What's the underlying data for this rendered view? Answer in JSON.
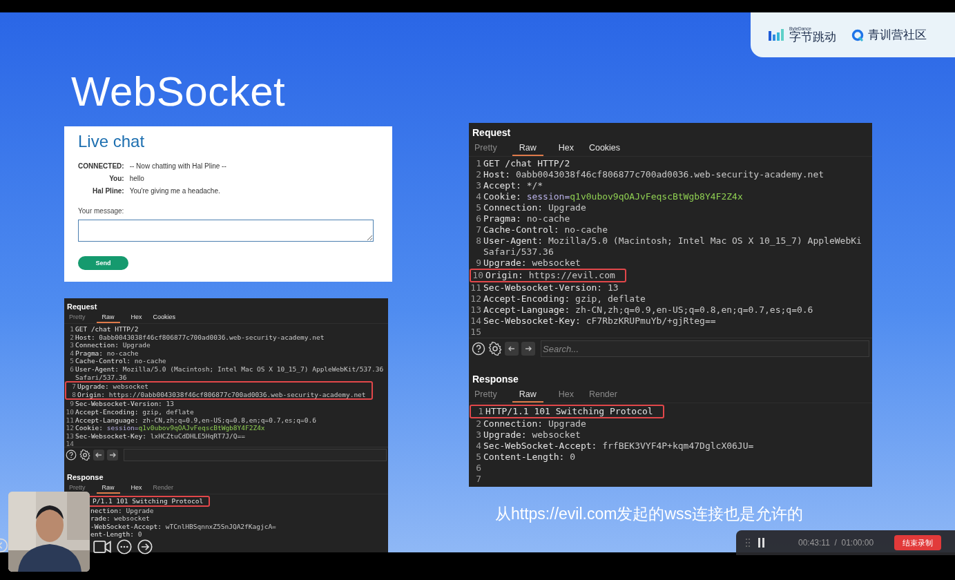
{
  "slide": {
    "title": "WebSocket",
    "logo": {
      "brand_small": "ByteDance",
      "brand": "字节跳动",
      "community": "青训营社区"
    },
    "chat": {
      "title": "Live chat",
      "messages": [
        {
          "sender": "CONNECTED:",
          "text": "-- Now chatting with Hal Pline --"
        },
        {
          "sender": "You:",
          "text": "hello"
        },
        {
          "sender": "Hal Pline:",
          "text": "You're giving me a headache."
        }
      ],
      "message_label": "Your message:",
      "send_button": "Send"
    },
    "left_panel": {
      "request": {
        "title": "Request",
        "tabs": [
          {
            "label": "Pretty",
            "selected": false,
            "disabled": true
          },
          {
            "label": "Raw",
            "selected": true,
            "disabled": false
          },
          {
            "label": "Hex",
            "selected": false,
            "disabled": false
          },
          {
            "label": "Cookies",
            "selected": false,
            "disabled": false
          }
        ],
        "lines": [
          {
            "n": "1",
            "text": "GET /chat HTTP/2",
            "highlighted": false
          },
          {
            "n": "2",
            "name": "Host:",
            "value": "0abb0043038f46cf806877c700ad0036.web-security-academy.net",
            "highlighted": false
          },
          {
            "n": "3",
            "name": "Connection:",
            "value": "Upgrade",
            "highlighted": false
          },
          {
            "n": "4",
            "name": "Pragma:",
            "value": "no-cache",
            "highlighted": false
          },
          {
            "n": "5",
            "name": "Cache-Control:",
            "value": "no-cache",
            "highlighted": false
          },
          {
            "n": "6",
            "name": "User-Agent:",
            "value": "Mozilla/5.0 (Macintosh; Intel Mac OS X 10_15_7) AppleWebKit/537.36",
            "highlighted": false
          },
          {
            "value": "Safari/537.36",
            "highlighted": false
          },
          {
            "n": "7",
            "name": "Upgrade:",
            "value": "websocket",
            "highlighted": true
          },
          {
            "n": "8",
            "name": "Origin:",
            "value": "https://0abb0043038f46cf806877c700ad0036.web-security-academy.net",
            "highlighted": true
          },
          {
            "n": "9",
            "name": "Sec-Websocket-Version:",
            "value": "13",
            "highlighted": false
          },
          {
            "n": "10",
            "name": "Accept-Encoding:",
            "value": "gzip, deflate",
            "highlighted": false
          },
          {
            "n": "11",
            "name": "Accept-Language:",
            "value": "zh-CN,zh;q=0.9,en-US;q=0.8,en;q=0.7,es;q=0.6",
            "highlighted": false
          },
          {
            "n": "12",
            "name": "Cookie:",
            "cookie_name": "session=",
            "value": "q1v0ubov9qOAJvFeqscBtWgb8Y4F2Z4x",
            "highlighted": false
          },
          {
            "n": "13",
            "name": "Sec-Websocket-Key:",
            "value": "lxHCZtuCdDHLE5HqRT7J/Q==",
            "highlighted": false
          },
          {
            "n": "14",
            "highlighted": false
          }
        ]
      },
      "response": {
        "title": "Response",
        "tabs": [
          {
            "label": "Pretty",
            "selected": false,
            "disabled": true
          },
          {
            "label": "Raw",
            "selected": true,
            "disabled": false
          },
          {
            "label": "Hex",
            "selected": false,
            "disabled": false
          },
          {
            "label": "Render",
            "selected": false,
            "disabled": true
          }
        ],
        "lines": [
          {
            "text": "P/1.1 101 Switching Protocol",
            "highlighted": true
          },
          {
            "name": "nection:",
            "value": "Upgrade",
            "highlighted": false
          },
          {
            "name": "rade:",
            "value": "websocket",
            "highlighted": false
          },
          {
            "name": "-WebSocket-Accept:",
            "value": "wTCnlHBSqnnxZ5SnJQA2fKagjcA=",
            "highlighted": false
          },
          {
            "name": "ent-Length:",
            "value": "0",
            "highlighted": false
          }
        ]
      }
    },
    "right_panel": {
      "request": {
        "title": "Request",
        "tabs": [
          {
            "label": "Pretty",
            "selected": false,
            "disabled": true
          },
          {
            "label": "Raw",
            "selected": true,
            "disabled": false
          },
          {
            "label": "Hex",
            "selected": false,
            "disabled": false
          },
          {
            "label": "Cookies",
            "selected": false,
            "disabled": false
          }
        ],
        "lines": [
          {
            "n": "1",
            "text": "GET /chat HTTP/2",
            "highlighted": false
          },
          {
            "n": "2",
            "name": "Host:",
            "value": "0abb0043038f46cf806877c700ad0036.web-security-academy.net",
            "highlighted": false
          },
          {
            "n": "3",
            "name": "Accept:",
            "value": "*/*",
            "highlighted": false
          },
          {
            "n": "4",
            "name": "Cookie:",
            "cookie_name": "session=",
            "value": "q1v0ubov9qOAJvFeqscBtWgb8Y4F2Z4x",
            "highlighted": false
          },
          {
            "n": "5",
            "name": "Connection:",
            "value": "Upgrade",
            "highlighted": false
          },
          {
            "n": "6",
            "name": "Pragma:",
            "value": "no-cache",
            "highlighted": false
          },
          {
            "n": "7",
            "name": "Cache-Control:",
            "value": "no-cache",
            "highlighted": false
          },
          {
            "n": "8",
            "name": "User-Agent:",
            "value": "Mozilla/5.0 (Macintosh; Intel Mac OS X 10_15_7) AppleWebKi",
            "highlighted": false
          },
          {
            "value": "Safari/537.36",
            "highlighted": false
          },
          {
            "n": "9",
            "name": "Upgrade:",
            "value": "websocket",
            "highlighted": false
          },
          {
            "n": "10",
            "name": "Origin:",
            "value": "https://evil.com",
            "highlighted": true
          },
          {
            "n": "11",
            "name": "Sec-Websocket-Version:",
            "value": "13",
            "highlighted": false
          },
          {
            "n": "12",
            "name": "Accept-Encoding:",
            "value": "gzip, deflate",
            "highlighted": false
          },
          {
            "n": "13",
            "name": "Accept-Language:",
            "value": "zh-CN,zh;q=0.9,en-US;q=0.8,en;q=0.7,es;q=0.6",
            "highlighted": false
          },
          {
            "n": "14",
            "name": "Sec-Websocket-Key:",
            "value": "cF7RbzKRUPmuYb/+gjRteg==",
            "highlighted": false
          },
          {
            "n": "15",
            "highlighted": false
          }
        ]
      },
      "search": {
        "placeholder": "Search..."
      },
      "response": {
        "title": "Response",
        "tabs": [
          {
            "label": "Pretty",
            "selected": false,
            "disabled": true
          },
          {
            "label": "Raw",
            "selected": true,
            "disabled": false
          },
          {
            "label": "Hex",
            "selected": false,
            "disabled": true
          },
          {
            "label": "Render",
            "selected": false,
            "disabled": true
          }
        ],
        "lines": [
          {
            "n": "1",
            "text": "HTTP/1.1 101 Switching Protocol",
            "highlighted": true
          },
          {
            "n": "2",
            "name": "Connection:",
            "value": "Upgrade",
            "highlighted": false
          },
          {
            "n": "3",
            "name": "Upgrade:",
            "value": "websocket",
            "highlighted": false
          },
          {
            "n": "4",
            "name": "Sec-WebSocket-Accept:",
            "value": "frfBEK3VYF4P+kqm47DglcX06JU=",
            "highlighted": false
          },
          {
            "n": "5",
            "name": "Content-Length:",
            "value": "0",
            "highlighted": false
          },
          {
            "n": "6",
            "highlighted": false
          },
          {
            "n": "7",
            "highlighted": false
          }
        ]
      }
    },
    "caption": "从https://evil.com发起的wss连接也是允许的"
  },
  "recorder": {
    "time": "00:43:11  /  01:00:00",
    "stop_button": "结束录制"
  }
}
